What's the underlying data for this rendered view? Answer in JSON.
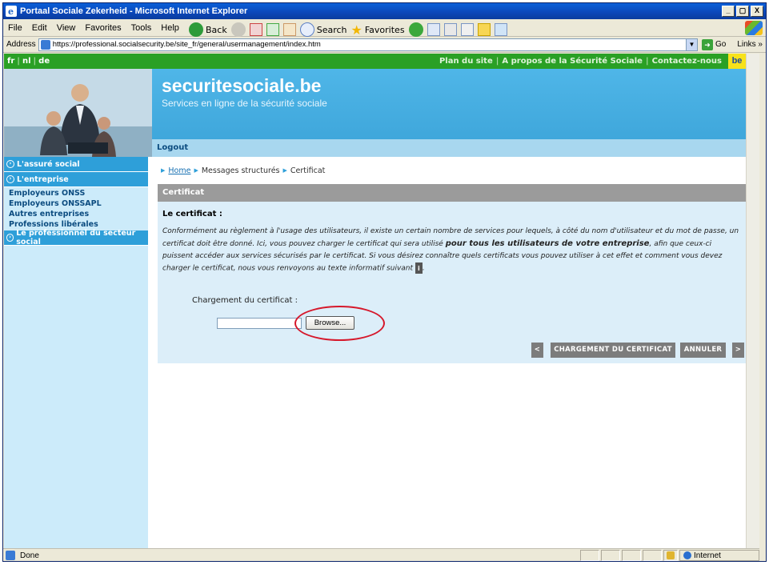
{
  "window": {
    "title": "Portaal Sociale Zekerheid - Microsoft Internet Explorer",
    "min_label": "_",
    "max_label": "▢",
    "close_label": "X"
  },
  "menubar": {
    "items": [
      "File",
      "Edit",
      "View",
      "Favorites",
      "Tools",
      "Help"
    ]
  },
  "toolbar": {
    "back_label": "Back",
    "search_label": "Search",
    "favorites_label": "Favorites"
  },
  "address": {
    "label": "Address",
    "url": "https://professional.socialsecurity.be/site_fr/general/usermanagement/index.htm",
    "go_label": "Go",
    "links_label": "Links »"
  },
  "site": {
    "languages": [
      "fr",
      "nl",
      "de"
    ],
    "top_links": [
      "Plan du site",
      "A propos de la Sécurité Sociale",
      "Contactez-nous"
    ],
    "be_logo": "be",
    "brand": "securitesociale.be",
    "tagline": "Services en ligne de la sécurité sociale",
    "logout_label": "Logout"
  },
  "sidebar": {
    "sections": [
      {
        "label": "L'assuré social",
        "items": []
      },
      {
        "label": "L'entreprise",
        "items": [
          "Employeurs ONSS",
          "Employeurs ONSSAPL",
          "Autres entreprises",
          "Professions libérales"
        ]
      },
      {
        "label": "Le professionnel du secteur social",
        "items": []
      }
    ]
  },
  "breadcrumb": {
    "home": "Home",
    "level2": "Messages structurés",
    "current": "Certificat"
  },
  "panel": {
    "title": "Certificat",
    "heading": "Le certificat :",
    "text_part1": "Conformément au règlement à l'usage des utilisateurs, il existe un certain nombre de services pour lequels, à côté du nom d'utilisateur et du mot de passe, un certificat doit être donné. Ici, vous pouvez charger le certificat qui sera utilisé ",
    "text_bold": "pour tous les utilisateurs de votre entreprise",
    "text_part2": ", afin que ceux-ci puissent accéder aux services sécurisés par le certificat. Si vous désirez connaître quels certificats vous pouvez utiliser à cet effet et comment vous devez charger le certificat, nous vous renvoyons au texte informatif suivant",
    "info_icon": "i",
    "upload_label": "Chargement du certificat :",
    "file_value": "",
    "browse_label": "Browse...",
    "prev_label": "<",
    "upload_button": "CHARGEMENT DU CERTIFICAT",
    "cancel_button": "ANNULER",
    "next_label": ">"
  },
  "status": {
    "text": "Done",
    "zone": "Internet"
  },
  "colors": {
    "site_green": "#2aa025",
    "banner_blue": "#3ba3d8",
    "sidebar_bg": "#ccebfa",
    "panel_bg": "#dceef9",
    "highlight_red": "#d6182b"
  }
}
